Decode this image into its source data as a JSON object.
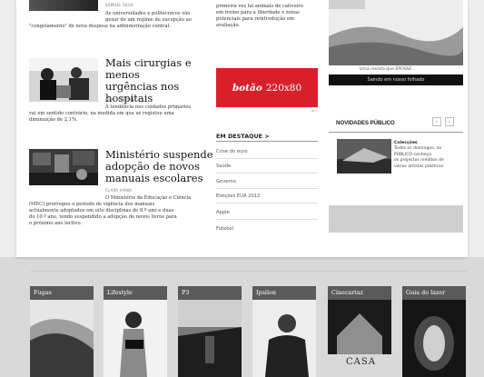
{
  "left": {
    "top_byline": "SAMUEL SILVA",
    "top_text_1": "As universidades e politécnicos vão",
    "top_text_2": "gozar de um regime de excepção ao",
    "top_text_3": "\"congelamento\" de nova despesa na administração central.",
    "story2": {
      "headline_1": "Mais cirurgias e menos",
      "headline_2": "urgências nos",
      "headline_3": "hospitais",
      "byline": "JOÃO D'ESPINEY",
      "text_1": "A tendência nos cuidados primários",
      "text_2": "vai em sentido contrário, na medida em que se registou uma",
      "text_3": "diminuição de 2,1%."
    },
    "story3": {
      "headline_1": "Ministério suspende",
      "headline_2": "adopção de novos",
      "headline_3": "manuais escolares",
      "byline": "CLARA VIANA",
      "text_1": "O Ministério da Educação e Ciência",
      "text_2": "(MEC) prorrogou o período de vigência dos manuais",
      "text_3": "actualmente adoptados em oito disciplinas do 8.º ano e duas",
      "text_4": "do 10.º ano, tendo suspendido a adopção de novos livros para",
      "text_5": "o próximo ano lectivo."
    }
  },
  "middle": {
    "top_text_1": "primeira vez há animais de cativeiro",
    "top_text_2": "em treino para a liberdade e zonas",
    "top_text_3": "potenciais para reintrodução em",
    "top_text_4": "avaliação.",
    "ad_bold": "botão",
    "ad_size": "220x80",
    "dest_title": "EM DESTAQUE >",
    "dest_items": [
      "Crise do euro",
      "Saúde",
      "Governo",
      "Eleições EUA 2012",
      "Apple",
      "Futebol"
    ]
  },
  "right": {
    "caption": "Uma revista que ÉPOSSE...",
    "black_bar": "Saindo em nosso folhado",
    "nov_title": "NOVIDADES PÚBLICO",
    "prev": "‹",
    "next": "›",
    "col_title": "Colecções",
    "col_text_1": "Todos os domingos, no",
    "col_text_2": "PÚBLICO conheça",
    "col_text_3": "os projectos inéditos de",
    "col_text_4": "vários artistas plásticos"
  },
  "tiles": [
    "Fugas",
    "Lifestyle",
    "P3",
    "Ipsilon",
    "Cinecartaz",
    "Guia do lazer"
  ],
  "tile_caption": "CASA"
}
